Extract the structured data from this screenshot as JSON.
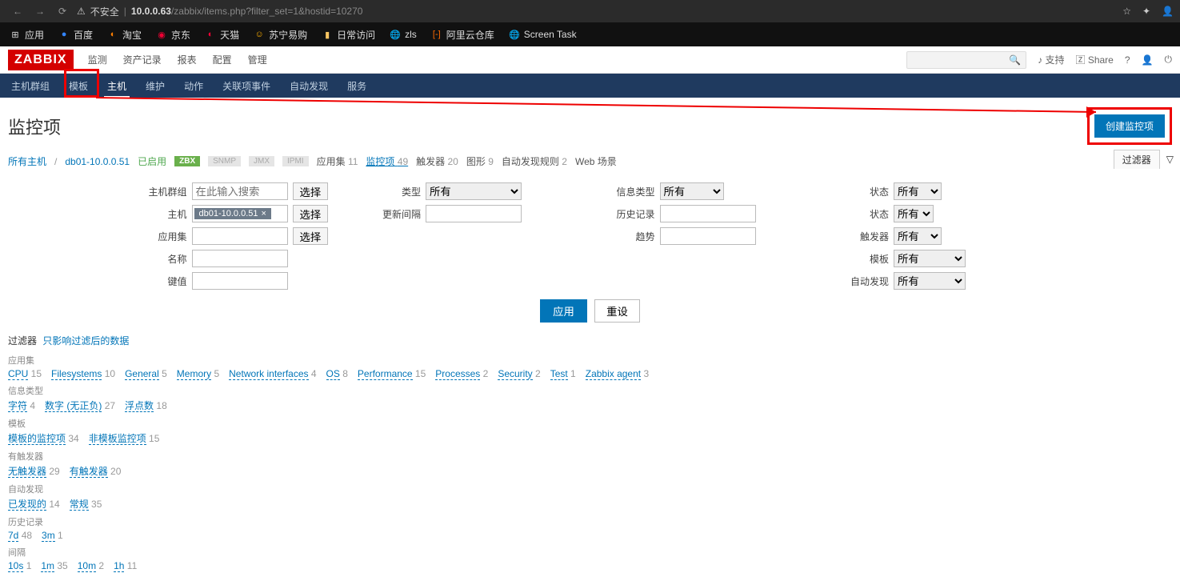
{
  "browser": {
    "security_label": "不安全",
    "url_host": "10.0.0.63",
    "url_path": "/zabbix/items.php?filter_set=1&hostid=10270"
  },
  "bookmarks": {
    "apps": "应用",
    "baidu": "百度",
    "taobao": "淘宝",
    "jd": "京东",
    "tmall": "天猫",
    "suning": "苏宁易购",
    "daily": "日常访问",
    "zls": "zls",
    "aliyun": "阿里云仓库",
    "screen": "Screen Task"
  },
  "header": {
    "logo": "ZABBIX",
    "nav": {
      "monitor": "监测",
      "assets": "资产记录",
      "reports": "报表",
      "config": "配置",
      "admin": "管理"
    },
    "support": "支持",
    "share": "Share"
  },
  "subnav": {
    "hostgroups": "主机群组",
    "templates": "模板",
    "hosts": "主机",
    "maintenance": "维护",
    "actions": "动作",
    "correlation": "关联项事件",
    "discovery": "自动发现",
    "services": "服务"
  },
  "page": {
    "title": "监控项",
    "create_btn": "创建监控项",
    "filter_label": "过滤器"
  },
  "breadcrumb": {
    "all_hosts": "所有主机",
    "host": "db01-10.0.0.51",
    "enabled": "已启用",
    "zbx": "ZBX",
    "snmp": "SNMP",
    "jmx": "JMX",
    "ipmi": "IPMI",
    "apps": {
      "label": "应用集",
      "count": "11"
    },
    "items": {
      "label": "监控项",
      "count": "49"
    },
    "triggers": {
      "label": "触发器",
      "count": "20"
    },
    "graphs": {
      "label": "图形",
      "count": "9"
    },
    "disc_rules": {
      "label": "自动发现规则",
      "count": "2"
    },
    "web": {
      "label": "Web 场景"
    }
  },
  "filter": {
    "labels": {
      "hostgroup": "主机群组",
      "host": "主机",
      "app": "应用集",
      "name": "名称",
      "key": "键值",
      "type": "类型",
      "interval": "更新间隔",
      "infotype": "信息类型",
      "history": "历史记录",
      "trends": "趋势",
      "state": "状态",
      "status": "状态",
      "triggers": "触发器",
      "template": "模板",
      "discovery": "自动发现"
    },
    "placeholder": "在此输入搜索",
    "host_tag": "db01-10.0.0.51",
    "select": "选择",
    "all": "所有",
    "apply": "应用",
    "reset": "重设"
  },
  "subfilter": {
    "title": "过滤器",
    "note": "只影响过滤后的数据",
    "groups": [
      {
        "name": "应用集",
        "items": [
          {
            "label": "CPU",
            "count": "15"
          },
          {
            "label": "Filesystems",
            "count": "10"
          },
          {
            "label": "General",
            "count": "5"
          },
          {
            "label": "Memory",
            "count": "5"
          },
          {
            "label": "Network interfaces",
            "count": "4"
          },
          {
            "label": "OS",
            "count": "8"
          },
          {
            "label": "Performance",
            "count": "15"
          },
          {
            "label": "Processes",
            "count": "2"
          },
          {
            "label": "Security",
            "count": "2"
          },
          {
            "label": "Test",
            "count": "1"
          },
          {
            "label": "Zabbix agent",
            "count": "3"
          }
        ]
      },
      {
        "name": "信息类型",
        "items": [
          {
            "label": "字符",
            "count": "4"
          },
          {
            "label": "数字 (无正负)",
            "count": "27"
          },
          {
            "label": "浮点数",
            "count": "18"
          }
        ]
      },
      {
        "name": "模板",
        "items": [
          {
            "label": "模板的监控项",
            "count": "34"
          },
          {
            "label": "非模板监控项",
            "count": "15"
          }
        ]
      },
      {
        "name": "有触发器",
        "items": [
          {
            "label": "无触发器",
            "count": "29"
          },
          {
            "label": "有触发器",
            "count": "20"
          }
        ]
      },
      {
        "name": "自动发现",
        "items": [
          {
            "label": "已发现的",
            "count": "14"
          },
          {
            "label": "常规",
            "count": "35"
          }
        ]
      },
      {
        "name": "历史记录",
        "items": [
          {
            "label": "7d",
            "count": "48"
          },
          {
            "label": "3m",
            "count": "1"
          }
        ]
      },
      {
        "name": "间隔",
        "items": [
          {
            "label": "10s",
            "count": "1"
          },
          {
            "label": "1m",
            "count": "35"
          },
          {
            "label": "10m",
            "count": "2"
          },
          {
            "label": "1h",
            "count": "11"
          }
        ]
      }
    ]
  }
}
